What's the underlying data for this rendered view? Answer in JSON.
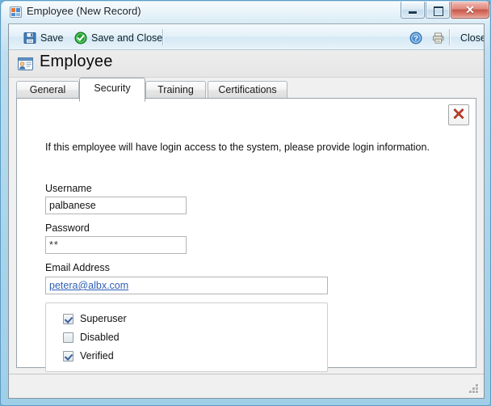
{
  "window": {
    "title": "Employee (New Record)",
    "title_icon": "form-window-icon",
    "buttons": {
      "minimize": "–",
      "maximize": "❐",
      "close": "✕"
    }
  },
  "toolbar": {
    "save_label": "Save",
    "save_and_close_label": "Save and Close",
    "help_tooltip": "Help",
    "print_tooltip": "Print",
    "close_label": "Close"
  },
  "header": {
    "title": "Employee",
    "icon": "employee-card-icon"
  },
  "tabs": [
    {
      "label": "General",
      "active": false
    },
    {
      "label": "Security",
      "active": true
    },
    {
      "label": "Training",
      "active": false
    },
    {
      "label": "Certifications",
      "active": false
    }
  ],
  "panel": {
    "delete_tooltip": "Delete",
    "intro": "If this employee will have login access to the system, please provide login information.",
    "fields": {
      "username": {
        "label": "Username",
        "value": "palbanese",
        "placeholder": ""
      },
      "password": {
        "label": "Password",
        "value": "**",
        "placeholder": ""
      },
      "email": {
        "label": "Email Address",
        "value": "petera@albx.com",
        "placeholder": ""
      }
    },
    "checkboxes": [
      {
        "label": "Superuser",
        "checked": true
      },
      {
        "label": "Disabled",
        "checked": false
      },
      {
        "label": "Verified",
        "checked": true
      }
    ]
  },
  "statusbar": {
    "text": "",
    "grip": "resize-grip"
  },
  "colors": {
    "accent": "#2f5fb4",
    "frame": "#a9d4ea",
    "close_red": "#c8564a",
    "tab_active_bg": "#ffffff",
    "panel_bg": "#ffffff"
  }
}
